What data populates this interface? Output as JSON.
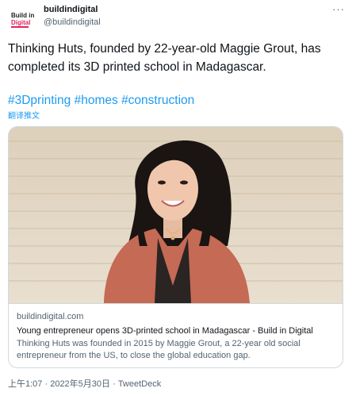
{
  "tweet": {
    "author": {
      "name": "buildindigital",
      "handle": "@buildindigital",
      "avatar_text_1": "Build in",
      "avatar_text_2": "Digital"
    },
    "more_icon": "more-icon",
    "text_line": "Thinking Huts, founded by 22-year-old Maggie Grout, has completed its 3D printed school in Madagascar.",
    "hashtags": [
      "#3Dprinting",
      "#homes",
      "#construction"
    ],
    "translate_label": "翻译推文"
  },
  "card": {
    "domain": "buildindigital.com",
    "title": "Young entrepreneur opens 3D-printed school in Madagascar - Build in Digital",
    "description": "Thinking Huts was founded in 2015 by Maggie Grout, a 22-year old social entrepreneur from the US, to close the global education gap."
  },
  "footer": {
    "time": "上午1:07",
    "separator": " · ",
    "date": "2022年5月30日",
    "app": "TweetDeck"
  },
  "colors": {
    "link": "#1d9bf0",
    "muted": "#536471",
    "border": "#cfd9de",
    "blazer": "#c46a55",
    "wall": "#e8dcc8"
  }
}
